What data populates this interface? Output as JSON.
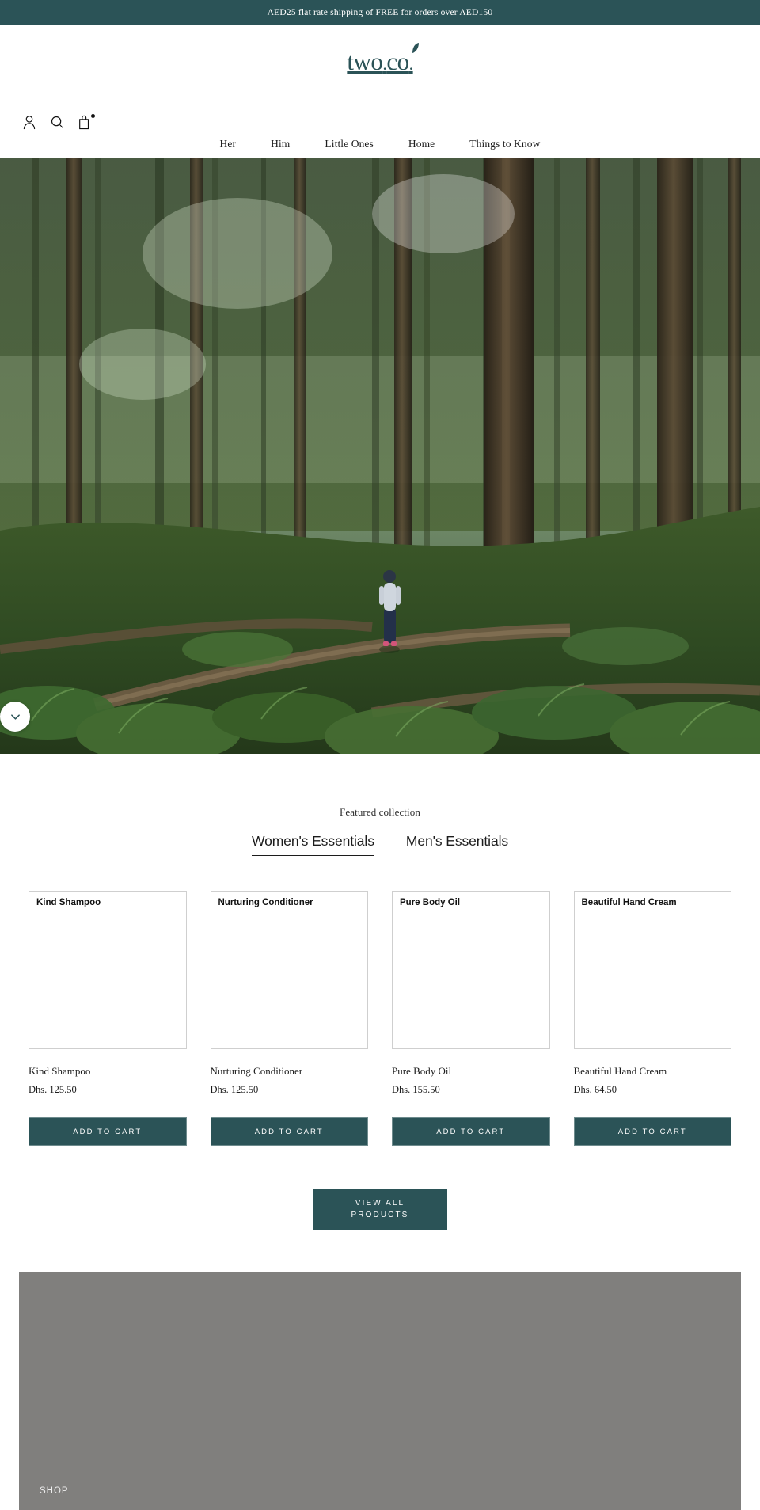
{
  "announcement": {
    "text": "AED25 flat rate shipping of FREE for orders over AED150",
    "background": "#2b5357",
    "color": "#ffffff"
  },
  "header": {
    "logo_text": "two",
    "logo_dot": ".",
    "logo_text2": "co",
    "logo_end": ".",
    "logo_color": "#2b5357",
    "icons": [
      {
        "name": "account-icon",
        "label": "Account"
      },
      {
        "name": "search-icon",
        "label": "Search"
      },
      {
        "name": "cart-icon",
        "label": "Cart"
      }
    ],
    "nav": [
      {
        "label": "Her"
      },
      {
        "label": "Him"
      },
      {
        "label": "Little Ones"
      },
      {
        "label": "Home"
      },
      {
        "label": "Things to Know"
      }
    ]
  },
  "hero": {
    "alt": "Person hiking through a tall evergreen forest with ferns and mossy fallen logs",
    "scroll_icon": "chevron-down-icon"
  },
  "featured": {
    "eyebrow": "Featured collection",
    "tabs": [
      {
        "label": "Women's Essentials",
        "active": true
      },
      {
        "label": "Men's Essentials",
        "active": false
      }
    ],
    "products": [
      {
        "image_alt": "Kind Shampoo",
        "title": "Kind Shampoo",
        "price": "Dhs. 125.50",
        "button": "ADD TO CART"
      },
      {
        "image_alt": "Nurturing Conditioner",
        "title": "Nurturing Conditioner",
        "price": "Dhs. 125.50",
        "button": "ADD TO CART"
      },
      {
        "image_alt": "Pure Body Oil",
        "title": "Pure Body Oil",
        "price": "Dhs. 155.50",
        "button": "ADD TO CART"
      },
      {
        "image_alt": "Beautiful Hand Cream",
        "title": "Beautiful Hand Cream",
        "price": "Dhs. 64.50",
        "button": "ADD TO CART"
      }
    ],
    "view_all_line1": "VIEW ALL",
    "view_all_line2": "PRODUCTS"
  },
  "shop_block": {
    "label": "SHOP",
    "background": "#807f7d"
  },
  "theme": {
    "accent": "#2b5357",
    "text": "#1c1c1c",
    "border": "#cfcfcf"
  }
}
